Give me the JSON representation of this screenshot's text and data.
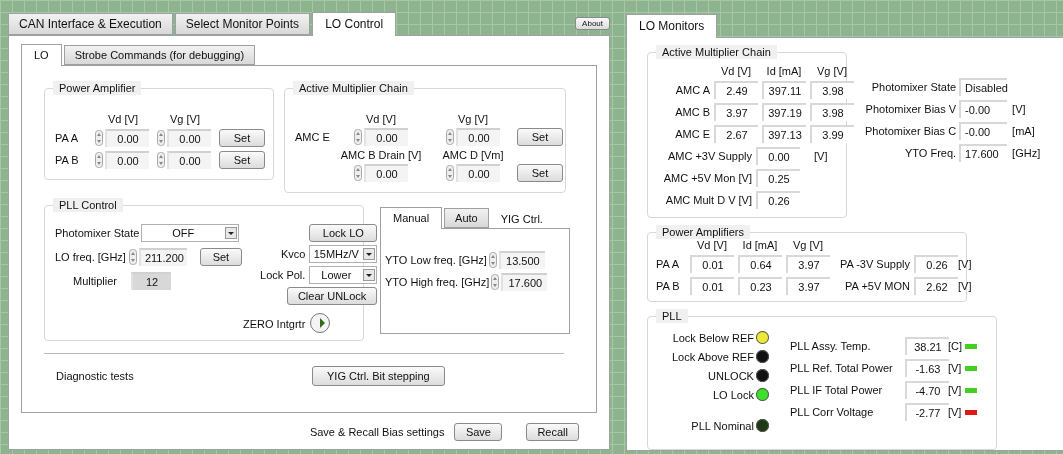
{
  "tabs": [
    {
      "label": "CAN Interface & Execution",
      "selected": false
    },
    {
      "label": "Select Monitor Points",
      "selected": false
    },
    {
      "label": "LO Control",
      "selected": true
    }
  ],
  "about_button": "About",
  "subtabs": [
    {
      "label": "LO",
      "selected": true
    },
    {
      "label": "Strobe Commands (for debugging)",
      "selected": false
    }
  ],
  "power_amplifier": {
    "title": "Power Amplifier",
    "columns": [
      "Vd [V]",
      "Vg [V]"
    ],
    "rows": [
      {
        "label": "PA A",
        "values": [
          "0.00",
          "0.00"
        ],
        "button": "Set"
      },
      {
        "label": "PA B",
        "values": [
          "0.00",
          "0.00"
        ],
        "button": "Set"
      }
    ]
  },
  "amc_control": {
    "title": "Active Multiplier Chain",
    "rows": [
      {
        "label": "AMC E",
        "fields": [
          {
            "label": "Vd [V]",
            "value": "0.00"
          },
          {
            "label": "Vg [V]",
            "value": "0.00"
          }
        ],
        "button": "Set"
      },
      {
        "fields": [
          {
            "label": "AMC B Drain [V]",
            "value": "0.00"
          },
          {
            "label": "AMC D [Vm]",
            "value": "0.00"
          }
        ],
        "button": "Set"
      }
    ]
  },
  "pll_control": {
    "title": "PLL Control",
    "photomixer_state": {
      "label": "Photomixer State",
      "value": "OFF"
    },
    "lo_freq": {
      "label": "LO freq. [GHz]",
      "value": "211.200",
      "button": "Set"
    },
    "multiplier": {
      "label": "Multiplier",
      "value": "12"
    },
    "lock_lo": "Lock LO",
    "kvco": {
      "label": "Kvco",
      "value": "15MHz/V"
    },
    "lock_pol": {
      "label": "Lock Pol.",
      "value": "Lower"
    },
    "clear_unlock": "Clear UNLock",
    "zero_integrator": {
      "label": "ZERO Intgrtr",
      "on": false
    }
  },
  "yig": {
    "tabs": [
      {
        "label": "Manual",
        "selected": true
      },
      {
        "label": "Auto",
        "selected": false
      },
      {
        "label": "YIG Ctrl.",
        "selected": false
      }
    ],
    "fields": [
      {
        "label": "YTO Low freq. [GHz]",
        "value": "13.500"
      },
      {
        "label": "YTO High freq. [GHz]",
        "value": "17.600"
      }
    ]
  },
  "diagnostic": {
    "label": "Diagnostic tests",
    "button": "YIG Ctrl. Bit stepping"
  },
  "save_recall": {
    "label": "Save & Recall Bias settings",
    "buttons": [
      "Save",
      "Recall"
    ]
  },
  "monitors": {
    "tab": "LO Monitors",
    "amc": {
      "title": "Active Multiplier Chain",
      "columns": [
        "Vd [V]",
        "Id [mA]",
        "Vg [V]"
      ],
      "rows": [
        {
          "label": "AMC A",
          "values": [
            "2.49",
            "397.11",
            "3.98"
          ]
        },
        {
          "label": "AMC B",
          "values": [
            "3.97",
            "397.19",
            "3.98"
          ]
        },
        {
          "label": "AMC E",
          "values": [
            "2.67",
            "397.13",
            "3.99"
          ]
        }
      ],
      "extras": [
        {
          "label": "AMC +3V Supply",
          "value": "0.00",
          "unit": "[V]"
        },
        {
          "label": "AMC +5V Mon [V]",
          "value": "0.25"
        },
        {
          "label": "AMC Mult D V [V]",
          "value": "0.26"
        }
      ]
    },
    "photomixer": [
      {
        "label": "Photomixer State",
        "value": "Disabled"
      },
      {
        "label": "Photomixer Bias V",
        "value": "-0.00",
        "unit": "[V]"
      },
      {
        "label": "Photomixer Bias C",
        "value": "-0.00",
        "unit": "[mA]"
      },
      {
        "label": "YTO Freq.",
        "value": "17.600",
        "unit": "[GHz]"
      }
    ],
    "power_amplifiers": {
      "title": "Power Amplifiers",
      "columns": [
        "Vd [V]",
        "Id [mA]",
        "Vg [V]"
      ],
      "rows": [
        {
          "label": "PA A",
          "values": [
            "0.01",
            "0.64",
            "3.97"
          ],
          "supply_label": "PA -3V Supply",
          "supply_value": "0.26",
          "unit": "[V]"
        },
        {
          "label": "PA B",
          "values": [
            "0.01",
            "0.23",
            "3.97"
          ],
          "supply_label": "PA +5V MON",
          "supply_value": "2.62",
          "unit": "[V]"
        }
      ]
    },
    "pll": {
      "title": "PLL",
      "leds": [
        {
          "label": "Lock  Below REF",
          "color": "#ece83a"
        },
        {
          "label": "Lock Above REF",
          "color": "#111111"
        },
        {
          "label": "UNLOCK",
          "color": "#111111"
        },
        {
          "label": "LO Lock",
          "color": "#3fe02a"
        },
        {
          "label": "PLL Nominal",
          "color": "#1e3a14"
        }
      ],
      "readings": [
        {
          "label": "PLL Assy. Temp.",
          "value": "38.21",
          "unit": "[C]",
          "color": "#44d020"
        },
        {
          "label": "PLL Ref. Total Power",
          "value": "-1.63",
          "unit": "[V]",
          "color": "#44d020"
        },
        {
          "label": "PLL IF Total Power",
          "value": "-4.70",
          "unit": "[V]",
          "color": "#44d020"
        },
        {
          "label": "PLL Corr Voltage",
          "value": "-2.77",
          "unit": "[V]",
          "color": "#e01818"
        }
      ]
    }
  }
}
